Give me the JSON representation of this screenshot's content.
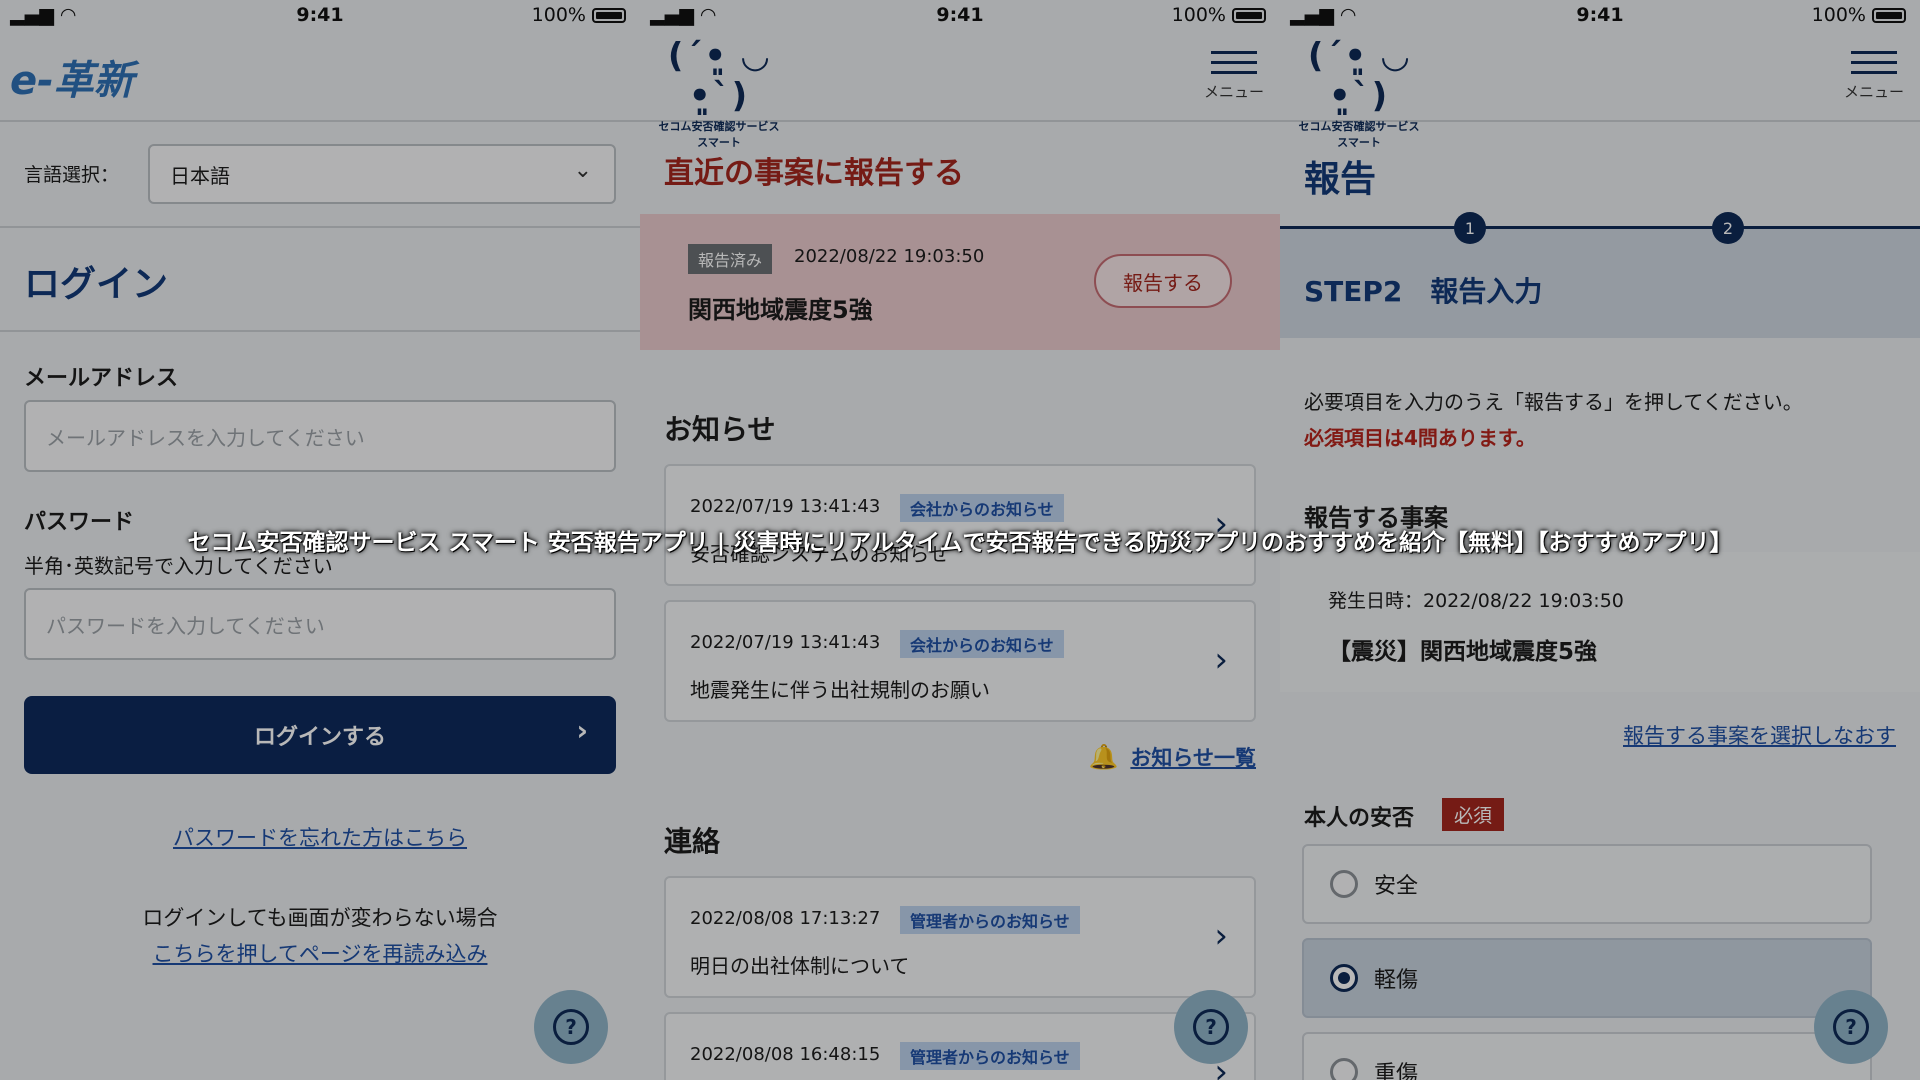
{
  "status": {
    "time": "9:41",
    "battery": "100%"
  },
  "login": {
    "logo": "e-革新",
    "language_label": "言語選択：",
    "language_value": "日本語",
    "title": "ログイン",
    "email_label": "メールアドレス",
    "email_placeholder": "メールアドレスを入力してください",
    "password_label": "パスワード",
    "password_hint": "半角･英数記号で入力してください",
    "password_placeholder": "パスワードを入力してください",
    "login_button": "ログインする",
    "forgot_link": "パスワードを忘れた方はこちら",
    "reload_note": "ログインしても画面が変わらない場合",
    "reload_link": "こちらを押してページを再読み込み"
  },
  "brand": {
    "caption": "セコム安否確認サービススマート",
    "menu_label": "メニュー"
  },
  "home": {
    "recent_title": "直近の事案に報告する",
    "recent": {
      "badge": "報告済み",
      "datetime": "2022/08/22 19:03:50",
      "name": "関西地域震度5強",
      "button": "報告する"
    },
    "notices_title": "お知らせ",
    "notices": [
      {
        "datetime": "2022/07/19 13:41:43",
        "tag": "会社からのお知らせ",
        "text": "安否確認システムのお知らせ"
      },
      {
        "datetime": "2022/07/19 13:41:43",
        "tag": "会社からのお知らせ",
        "text": "地震発生に伴う出社規制のお願い"
      }
    ],
    "notices_link": "お知らせ一覧",
    "contact_title": "連絡",
    "contacts": [
      {
        "datetime": "2022/08/08 17:13:27",
        "tag": "管理者からのお知らせ",
        "text": "明日の出社体制について"
      },
      {
        "datetime": "2022/08/08 16:48:15",
        "tag": "管理者からのお知らせ",
        "text": ""
      }
    ]
  },
  "report": {
    "title": "報告",
    "steps": [
      "1",
      "2"
    ],
    "step_title": "STEP2　報告入力",
    "instruction": "必要項目を入力のうえ「報告する」を押してください。",
    "required_note": "必須項目は4問あります。",
    "section_title": "報告する事案",
    "occurred_label": "発生日時：2022/08/22 19:03:50",
    "incident_name": "【震災】関西地域震度5強",
    "reselect_link": "報告する事案を選択しなおす",
    "safety_label": "本人の安否",
    "required_badge": "必須",
    "options": [
      "安全",
      "軽傷",
      "重傷"
    ],
    "selected": "軽傷"
  },
  "caption": "セコム安否確認サービス スマート 安否報告アプリ | 災害時にリアルタイムで安否報告できる防災アプリのおすすめを紹介【無料】【おすすめアプリ】"
}
